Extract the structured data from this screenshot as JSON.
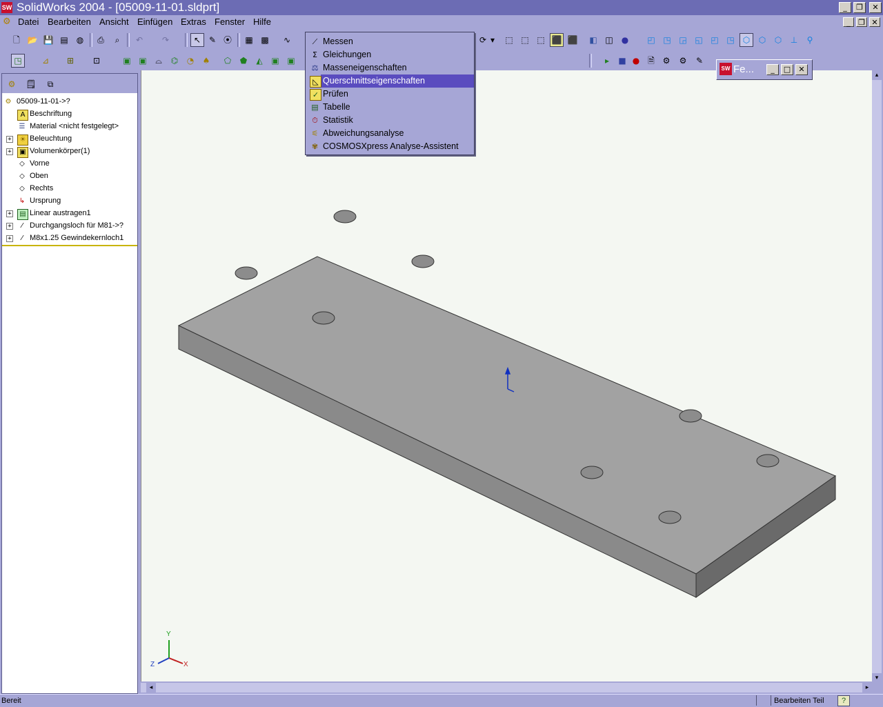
{
  "window": {
    "title": "SolidWorks 2004 - [05009-11-01.sldprt]",
    "app_icon": "SW"
  },
  "menu": [
    "Datei",
    "Bearbeiten",
    "Ansicht",
    "Einfügen",
    "Extras",
    "Fenster",
    "Hilfe"
  ],
  "dropdown": {
    "items": [
      {
        "label": "Messen",
        "icon": "measure-icon"
      },
      {
        "label": "Gleichungen",
        "icon": "sigma-icon"
      },
      {
        "label": "Masseneigenschaften",
        "icon": "scale-icon"
      },
      {
        "label": "Querschnittseigenschaften",
        "icon": "section-icon",
        "selected": true
      },
      {
        "label": "Prüfen",
        "icon": "check-icon"
      },
      {
        "label": "Tabelle",
        "icon": "table-icon"
      },
      {
        "label": "Statistik",
        "icon": "stopwatch-icon"
      },
      {
        "label": "Abweichungsanalyse",
        "icon": "deviation-icon"
      },
      {
        "label": "COSMOSXpress Analyse-Assistent",
        "icon": "cosmos-icon"
      }
    ]
  },
  "tree": {
    "root": "05009-11-01->?",
    "items": [
      {
        "label": "Beschriftung",
        "icon": "annotation-icon",
        "expandable": false
      },
      {
        "label": "Material <nicht festgelegt>",
        "icon": "material-icon",
        "expandable": false
      },
      {
        "label": "Beleuchtung",
        "icon": "lighting-icon",
        "expandable": true
      },
      {
        "label": "Volumenkörper(1)",
        "icon": "solid-body-icon",
        "expandable": true
      },
      {
        "label": "Vorne",
        "icon": "plane-icon",
        "expandable": false
      },
      {
        "label": "Oben",
        "icon": "plane-icon",
        "expandable": false
      },
      {
        "label": "Rechts",
        "icon": "plane-icon",
        "expandable": false
      },
      {
        "label": "Ursprung",
        "icon": "origin-icon",
        "expandable": false
      },
      {
        "label": "Linear austragen1",
        "icon": "extrude-icon",
        "expandable": true
      },
      {
        "label": "Durchgangsloch für M81->?",
        "icon": "hole-icon",
        "expandable": true
      },
      {
        "label": "M8x1.25 Gewindekernloch1",
        "icon": "hole-icon",
        "expandable": true
      }
    ]
  },
  "floating_window": {
    "title": "Fe..."
  },
  "triad": {
    "x": "X",
    "y": "Y",
    "z": "Z"
  },
  "status": {
    "left": "Bereit",
    "right": "Bearbeiten Teil",
    "help": "?"
  },
  "colors": {
    "titlebar": "#6c6cb4",
    "chrome": "#a6a6d6",
    "selection": "#5a4cbf",
    "viewport": "#f4f7f2",
    "part": "#a0a0a0"
  }
}
